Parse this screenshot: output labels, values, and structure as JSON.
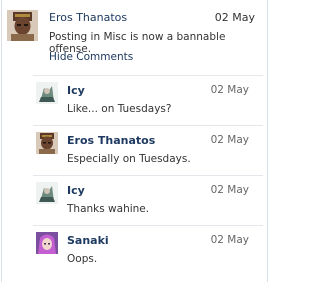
{
  "post": {
    "author": "Eros Thanatos",
    "date": "02 May",
    "text": "Posting in Misc is now a bannable offense.",
    "hide_comments_label": "Hide Comments"
  },
  "comments": [
    {
      "author": "Icy",
      "date": "02 May",
      "text": "Like... on Tuesdays?"
    },
    {
      "author": "Eros Thanatos",
      "date": "02 May",
      "text": "Especially on Tuesdays."
    },
    {
      "author": "Icy",
      "date": "02 May",
      "text": "Thanks wahine."
    },
    {
      "author": "Sanaki",
      "date": "02 May",
      "text": "Oops."
    }
  ]
}
